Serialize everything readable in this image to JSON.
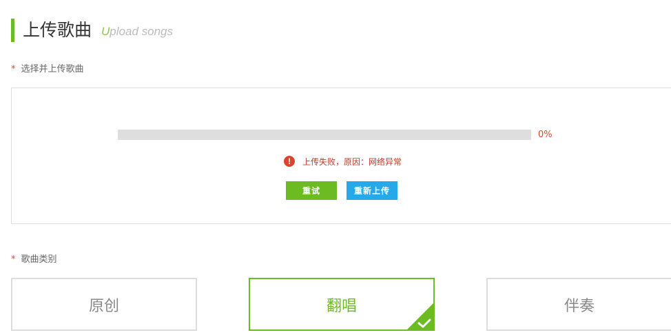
{
  "heading": {
    "title": "上传歌曲",
    "subtitle_first": "U",
    "subtitle_rest": "pload songs"
  },
  "upload_field": {
    "required_mark": "*",
    "label": "选择并上传歌曲",
    "progress_percent": 0,
    "progress_text": "0%",
    "error_icon_glyph": "!",
    "error_message": "上传失败，原因：网络异常",
    "retry_label": "重试",
    "reupload_label": "重新上传"
  },
  "category_field": {
    "required_mark": "*",
    "label": "歌曲类别",
    "options": [
      {
        "label": "原创",
        "selected": false
      },
      {
        "label": "翻唱",
        "selected": true
      },
      {
        "label": "伴奏",
        "selected": false
      }
    ]
  },
  "colors": {
    "accent_green": "#6cbb22",
    "accent_blue": "#25a9e8",
    "error_red": "#d9462f"
  },
  "icons": {
    "error": "exclamation-circle-icon",
    "selected": "checkmark-icon"
  }
}
